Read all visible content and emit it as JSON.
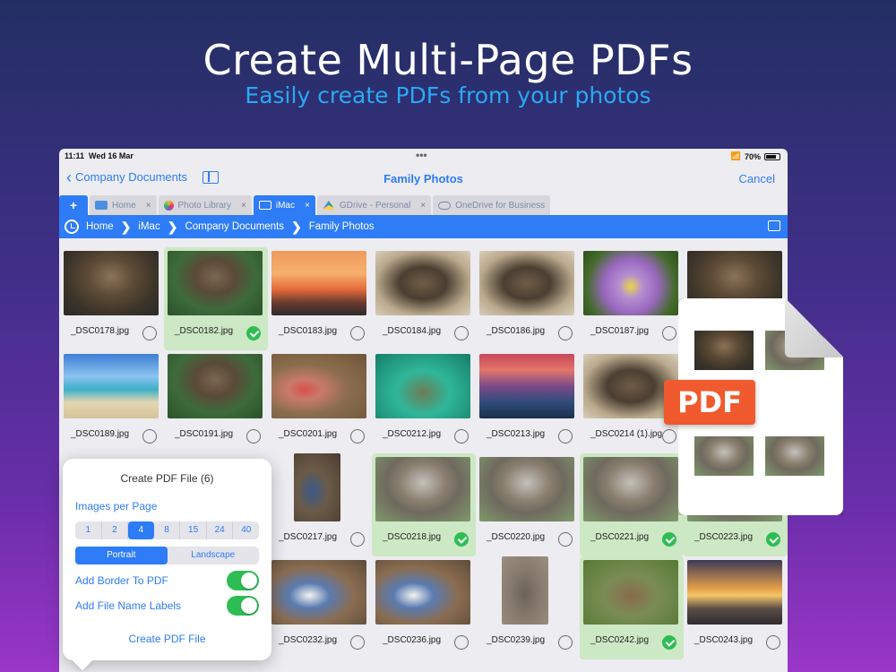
{
  "hero": {
    "title": "Create Multi-Page PDFs",
    "subtitle": "Easily create PDFs from your photos"
  },
  "status": {
    "time": "11:11",
    "date": "Wed 16 Mar",
    "battery": "70%"
  },
  "nav": {
    "back_label": "Company Documents",
    "title": "Family Photos",
    "cancel_label": "Cancel"
  },
  "tabs": [
    {
      "label": "Home",
      "icon": "folder-icon"
    },
    {
      "label": "Photo Library",
      "icon": "photos-icon"
    },
    {
      "label": "iMac",
      "icon": "monitor-icon",
      "active": true
    },
    {
      "label": "GDrive - Personal",
      "icon": "gdrive-icon"
    },
    {
      "label": "OneDrive for Business",
      "icon": "cloud-icon"
    }
  ],
  "breadcrumb": [
    "Home",
    "iMac",
    "Company Documents",
    "Family Photos"
  ],
  "files": [
    [
      "_DSC0178.jpg",
      "_DSC0182.jpg",
      "_DSC0183.jpg",
      "_DSC0184.jpg",
      "_DSC0186.jpg",
      "_DSC0187.jpg",
      ""
    ],
    [
      "_DSC0189.jpg",
      "_DSC0191.jpg",
      "_DSC0201.jpg",
      "_DSC0212.jpg",
      "_DSC0213.jpg",
      "_DSC0214 (1).jpg",
      ""
    ],
    [
      "",
      "",
      "_DSC0217.jpg",
      "_DSC0218.jpg",
      "_DSC0220.jpg",
      "_DSC0221.jpg",
      "_DSC0223.jpg"
    ],
    [
      "",
      "",
      "_DSC0232.jpg",
      "_DSC0236.jpg",
      "_DSC0239.jpg",
      "_DSC0242.jpg",
      "_DSC0243.jpg"
    ]
  ],
  "popover": {
    "title": "Create PDF File (6)",
    "images_per_page_label": "Images per Page",
    "options": [
      "1",
      "2",
      "4",
      "8",
      "15",
      "24",
      "40"
    ],
    "selected_option": "4",
    "orientation": [
      "Portrait",
      "Landscape"
    ],
    "selected_orientation": "Portrait",
    "add_border_label": "Add Border To PDF",
    "add_border_on": true,
    "add_labels_label": "Add File Name Labels",
    "add_labels_on": true,
    "action_label": "Create PDF File"
  },
  "pdf_badge": "PDF",
  "colors": {
    "accent": "#2e7cf6",
    "selected_bg": "#cde8c4",
    "check_green": "#2ebd55",
    "pdf_orange": "#f05a2e"
  }
}
